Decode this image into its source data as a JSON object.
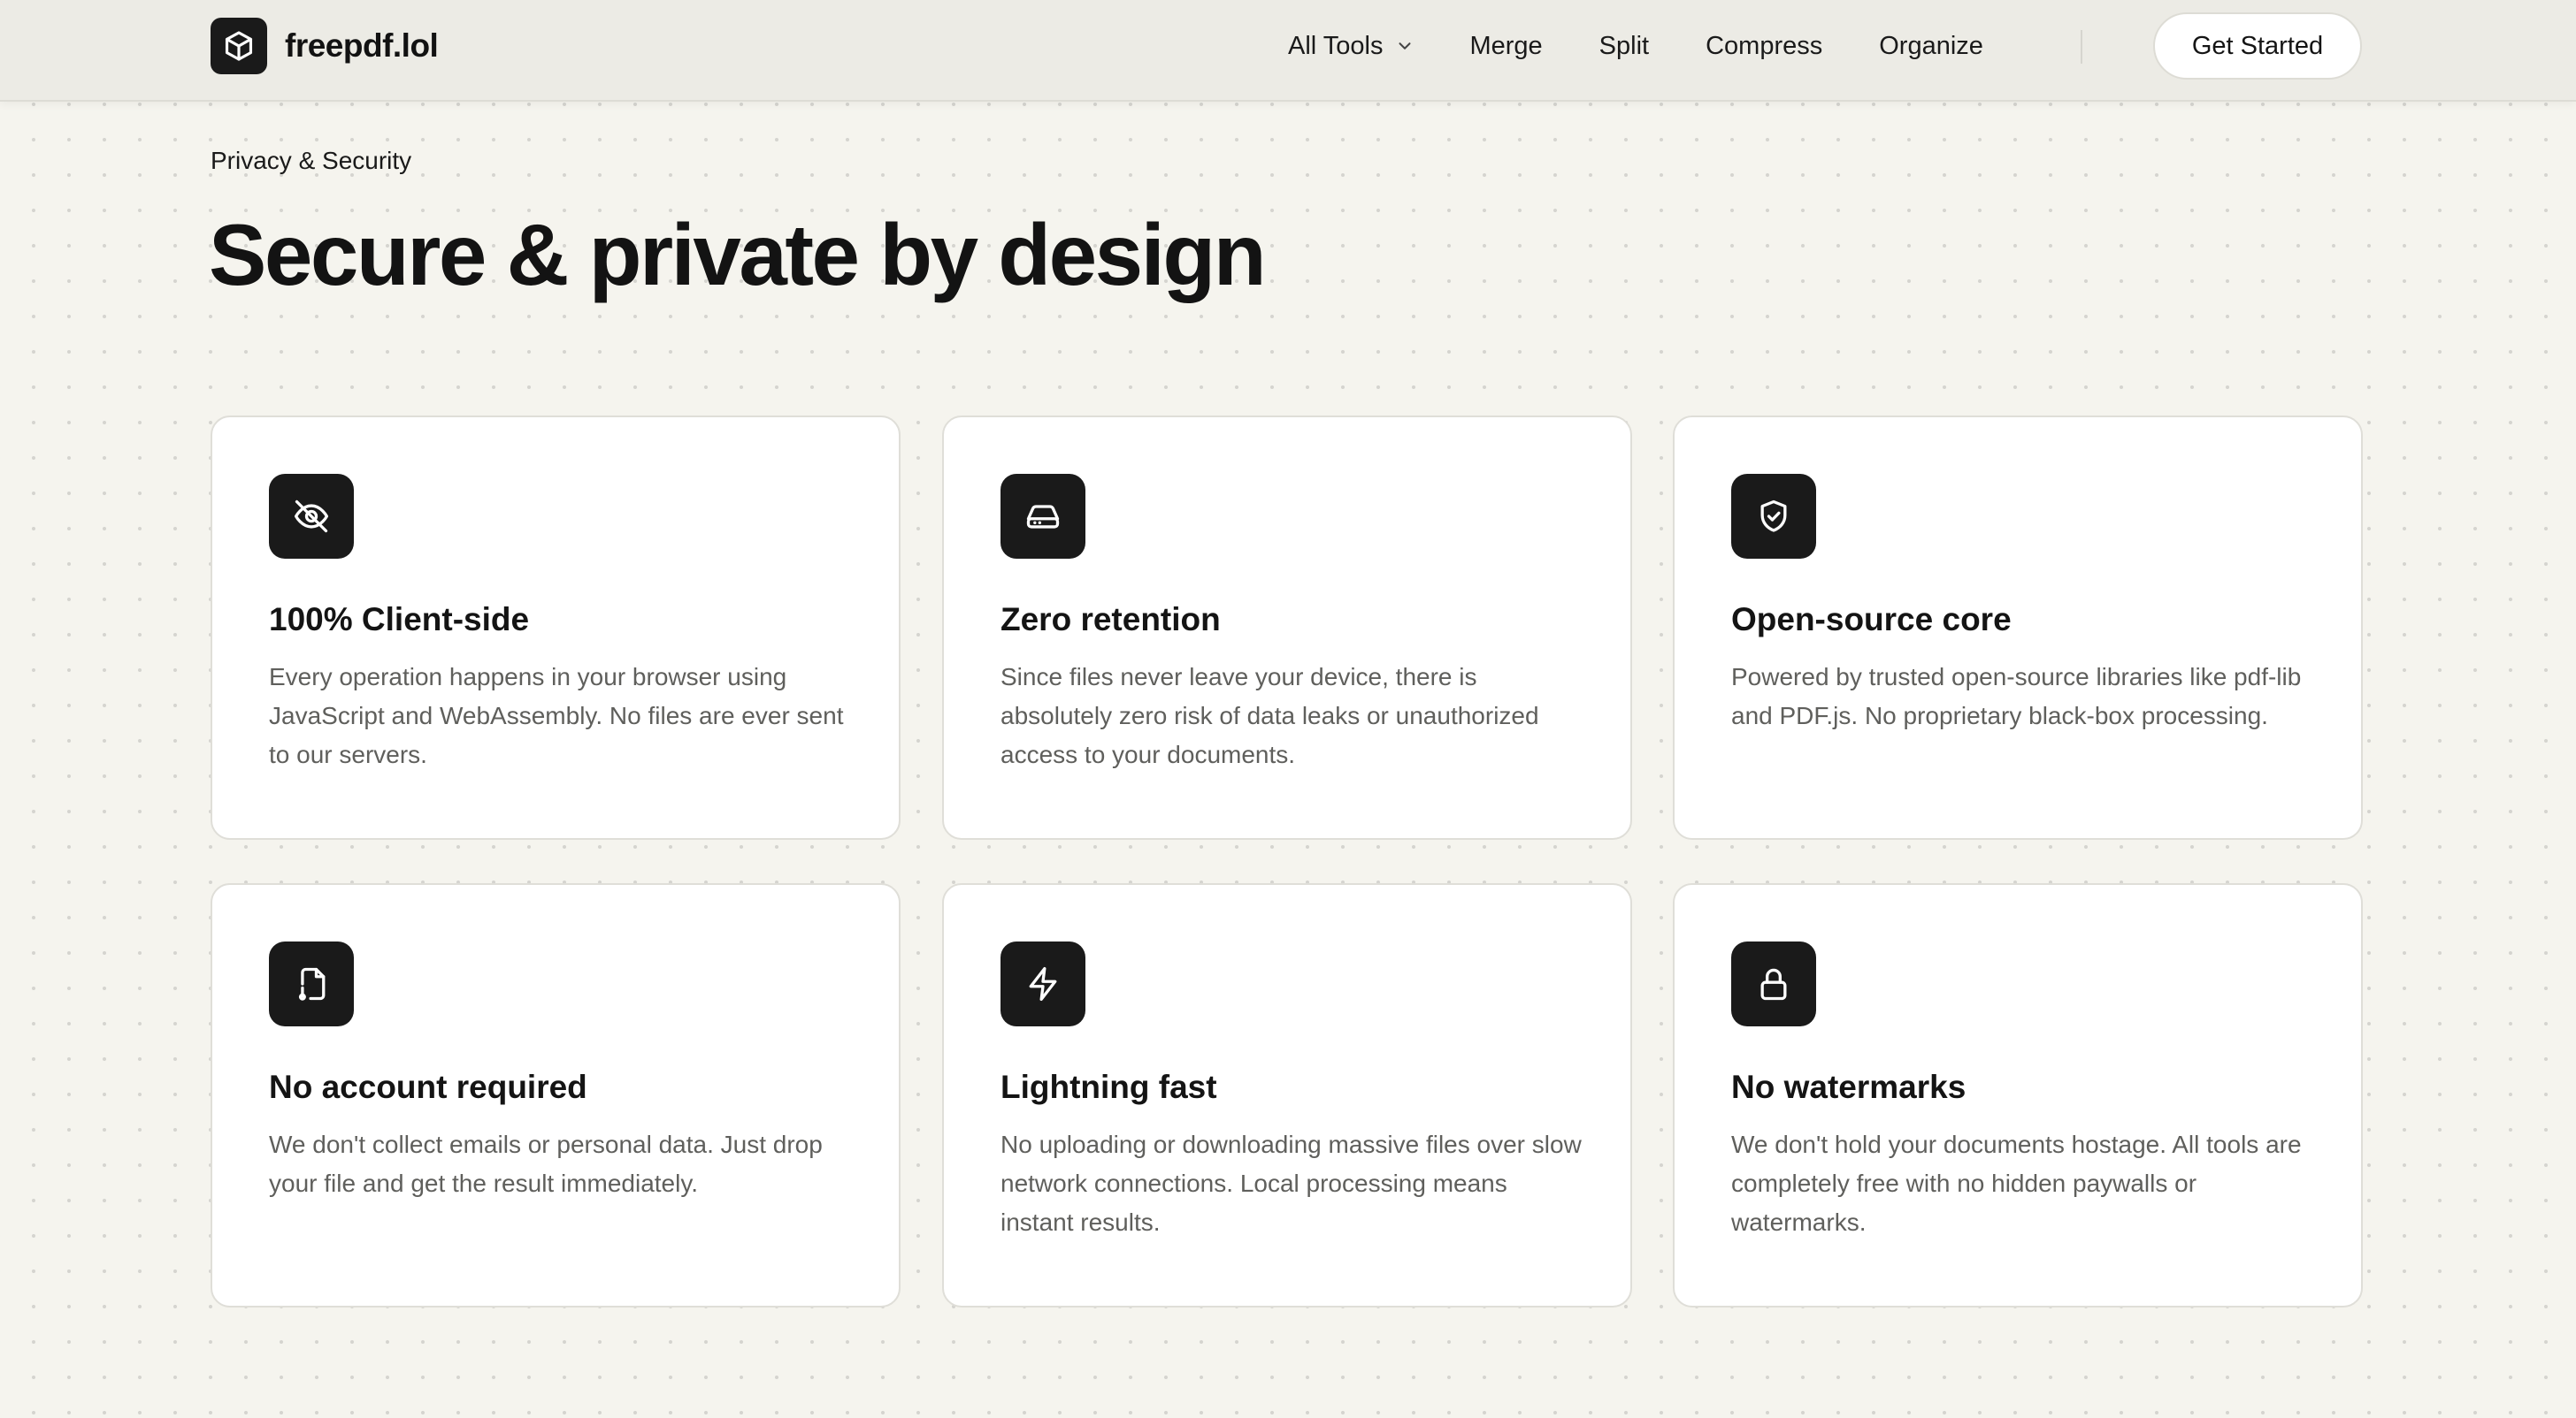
{
  "brand": {
    "name": "freepdf.lol",
    "logo_icon": "cube-icon"
  },
  "nav": {
    "all_tools": "All Tools",
    "merge": "Merge",
    "split": "Split",
    "compress": "Compress",
    "organize": "Organize",
    "cta": "Get Started"
  },
  "hero": {
    "eyebrow": "Privacy & Security",
    "title": "Secure & private by design"
  },
  "features": [
    {
      "icon": "eye-off-icon",
      "title": "100% Client-side",
      "description": "Every operation happens in your browser using JavaScript and WebAssembly. No files are ever sent to our servers."
    },
    {
      "icon": "hard-drive-icon",
      "title": "Zero retention",
      "description": "Since files never leave your device, there is absolutely zero risk of data leaks or unauthorized access to your documents."
    },
    {
      "icon": "shield-check-icon",
      "title": "Open-source core",
      "description": "Powered by trusted open-source libraries like pdf-lib and PDF.js. No proprietary black-box processing."
    },
    {
      "icon": "file-lock-icon",
      "title": "No account required",
      "description": "We don't collect emails or personal data. Just drop your file and get the result immediately."
    },
    {
      "icon": "lightning-icon",
      "title": "Lightning fast",
      "description": "No uploading or downloading massive files over slow network connections. Local processing means instant results."
    },
    {
      "icon": "lock-icon",
      "title": "No watermarks",
      "description": "We don't hold your documents hostage. All tools are completely free with no hidden paywalls or watermarks."
    }
  ],
  "colors": {
    "background": "#f5f4ee",
    "header": "#ecebe5",
    "card": "#ffffff",
    "icon_tile": "#1a1a1a",
    "text_primary": "#141414",
    "text_secondary": "#5f5f5c"
  }
}
